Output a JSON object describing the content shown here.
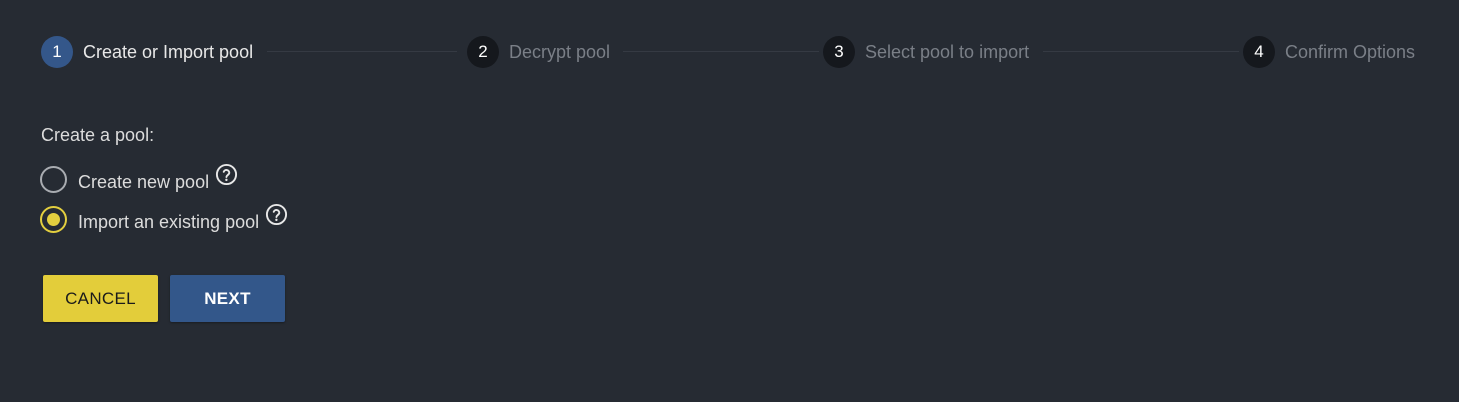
{
  "stepper": {
    "steps": [
      {
        "number": "1",
        "label": "Create or Import pool",
        "active": true
      },
      {
        "number": "2",
        "label": "Decrypt pool",
        "active": false
      },
      {
        "number": "3",
        "label": "Select pool to import",
        "active": false
      },
      {
        "number": "4",
        "label": "Confirm Options",
        "active": false
      }
    ]
  },
  "form": {
    "title": "Create a pool:",
    "options": [
      {
        "label": "Create new pool",
        "selected": false,
        "icon": "help-circle-icon"
      },
      {
        "label": "Import an existing pool",
        "selected": true,
        "icon": "help-circle-icon"
      }
    ]
  },
  "actions": {
    "cancel_label": "CANCEL",
    "next_label": "NEXT"
  },
  "colors": {
    "background": "#262b33",
    "accent_yellow": "#e3cd3a",
    "accent_blue": "#33578a",
    "step_inactive": "#15181d"
  }
}
